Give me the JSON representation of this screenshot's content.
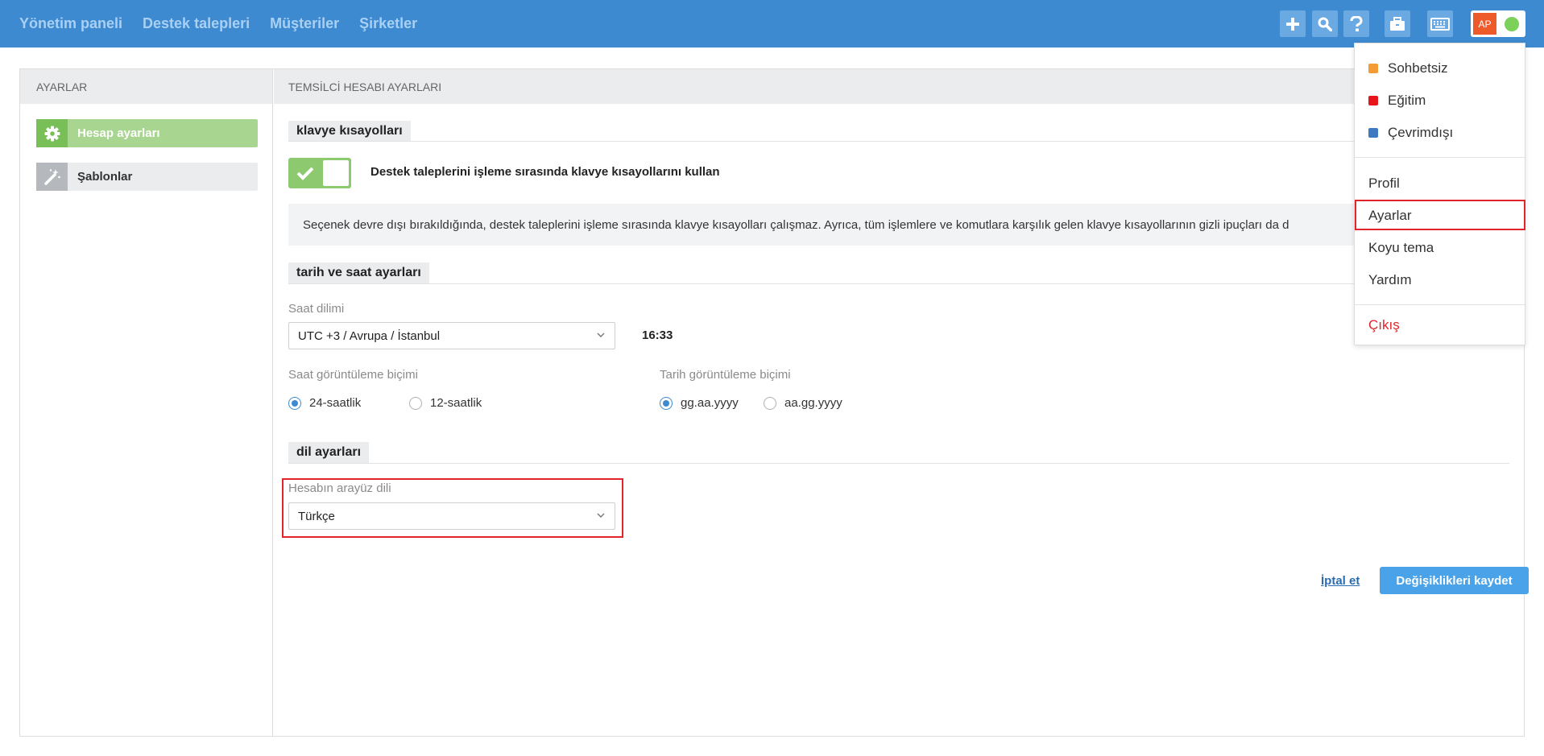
{
  "topnav": {
    "items": [
      "Yönetim paneli",
      "Destek talepleri",
      "Müşteriler",
      "Şirketler"
    ]
  },
  "toolbar": {
    "icons": [
      "plus-icon",
      "search-icon",
      "help-icon",
      "briefcase-icon",
      "keyboard-icon"
    ],
    "avatar_initials": "AP",
    "status_color": "#7bd15a"
  },
  "sidebar": {
    "heading": "AYARLAR",
    "items": [
      {
        "label": "Hesap ayarları",
        "icon": "gear-icon",
        "active": true
      },
      {
        "label": "Şablonlar",
        "icon": "magic-wand-icon",
        "active": false
      }
    ]
  },
  "main": {
    "heading": "TEMSİLCİ HESABI AYARLARI",
    "keyboard": {
      "title": "klavye kısayolları",
      "toggle_label": "Destek taleplerini işleme sırasında klavye kısayollarını kullan",
      "toggle_on": true,
      "info": "Seçenek devre dışı bırakıldığında, destek taleplerini işleme sırasında klavye kısayolları çalışmaz. Ayrıca, tüm işlemlere ve komutlara karşılık gelen klavye kısayollarının gizli ipuçları da d"
    },
    "datetime": {
      "title": "tarih ve saat ayarları",
      "timezone_label": "Saat dilimi",
      "timezone_value": "UTC +3 / Avrupa / İstanbul",
      "current_time": "16:33",
      "time_format_label": "Saat görüntüleme biçimi",
      "time_formats": [
        {
          "label": "24-saatlik",
          "selected": true
        },
        {
          "label": "12-saatlik",
          "selected": false
        }
      ],
      "date_format_label": "Tarih görüntüleme biçimi",
      "date_formats": [
        {
          "label": "gg.aa.yyyy",
          "selected": true
        },
        {
          "label": "aa.gg.yyyy",
          "selected": false
        }
      ]
    },
    "language": {
      "title": "dil ayarları",
      "label": "Hesabın arayüz dili",
      "value": "Türkçe"
    },
    "actions": {
      "cancel": "İptal et",
      "save": "Değişiklikleri kaydet"
    }
  },
  "user_menu": {
    "statuses": [
      {
        "label": "Sohbetsiz",
        "color": "#f39c33"
      },
      {
        "label": "Eğitim",
        "color": "#e8141b"
      },
      {
        "label": "Çevrimdışı",
        "color": "#3d7ac0"
      }
    ],
    "items": [
      "Profil",
      "Ayarlar",
      "Koyu tema",
      "Yardım"
    ],
    "logout": "Çıkış"
  },
  "colors": {
    "topbar": "#3d8ad0",
    "highlight": "#e0262b",
    "accent_green": "#78bf57"
  }
}
